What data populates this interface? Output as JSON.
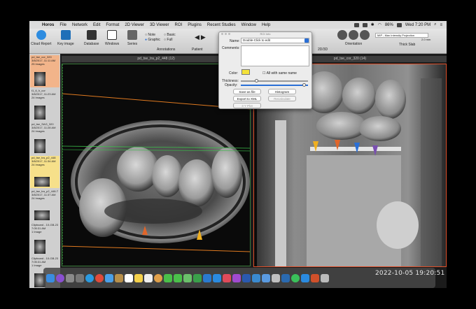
{
  "menubar": {
    "items": [
      "Horos",
      "File",
      "Network",
      "Edit",
      "Format",
      "2D Viewer",
      "3D Viewer",
      "ROI",
      "Plugins",
      "Recent Studies",
      "Window",
      "Help"
    ],
    "battery": "86%",
    "clock": "Wed 7:20 PM"
  },
  "toolbar": {
    "cloud_report": "Cloud Report",
    "key_image": "Key image",
    "database": "Database",
    "windows": "Windows",
    "series": "Series",
    "annotations": "Annotations",
    "patient": "Patient",
    "radio_note": "Note",
    "radio_graphic": "Graphic",
    "radio_basic": "Basic",
    "radio_full": "Full",
    "mode_2030": "2D/3D",
    "orientation": "Orientation",
    "thick_slab": "Thick Slab",
    "slab_mode": "MIP - Max Intensity Projection",
    "slab_value": "2.0 mm"
  },
  "thumbnails": [
    {
      "name": "pd_tse_cor_320",
      "date": "3/8/2017, 11:11 AM",
      "count": "25 Images"
    },
    {
      "name": "t1_tl_h_cor",
      "date": "3/8/2017, 11:23 AM",
      "count": "24 Images"
    },
    {
      "name": "pd_tse_SAG_320",
      "date": "3/8/2017, 11:28 AM",
      "count": "24 Images"
    },
    {
      "name": "pd_tse_tra_p2_448",
      "date": "3/8/2017, 11:34 AM",
      "count": "24 Images"
    },
    {
      "name": "pd_tse_tra_p2_448-T",
      "date": "3/8/2017, 11:37 AM",
      "count": "24 Images"
    },
    {
      "name": "Clipboard - 10-GB-23",
      "date": "7:05:31 AM",
      "count": "1 Image"
    },
    {
      "name": "Clipboard - 10-GB-23",
      "date": "7:05:31 AM",
      "count": "1 Image"
    }
  ],
  "viewers": {
    "left_title": "pd_tse_tra_p2_448 (12)",
    "right_title": "pd_tse_cor_320 (14)"
  },
  "roi_dialog": {
    "title": "ROI Info",
    "name_label": "Name:",
    "name_value": "Double-Click to edit",
    "comments_label": "Comments:",
    "color_label": "Color:",
    "all_same_name": "All with same name",
    "thickness_label": "Thickness:",
    "opacity_label": "Opacity:",
    "save_as_file": "Save as file",
    "histogram": "Histogram",
    "export_xml": "Export to XML",
    "recalculate": "Recalculate",
    "plot": "3 Y Plot",
    "color_value": "#f4e23a"
  },
  "dock_clock": "2022-10-05 19:20:51",
  "colors": {
    "arrow_orange": "#e0652a",
    "arrow_yellow": "#f0b020",
    "arrow_blue": "#2a6fd6",
    "arrow_purple": "#7a4fb0",
    "crosshair_orange": "#e07a20",
    "crosshair_green": "#3bbf4a"
  }
}
